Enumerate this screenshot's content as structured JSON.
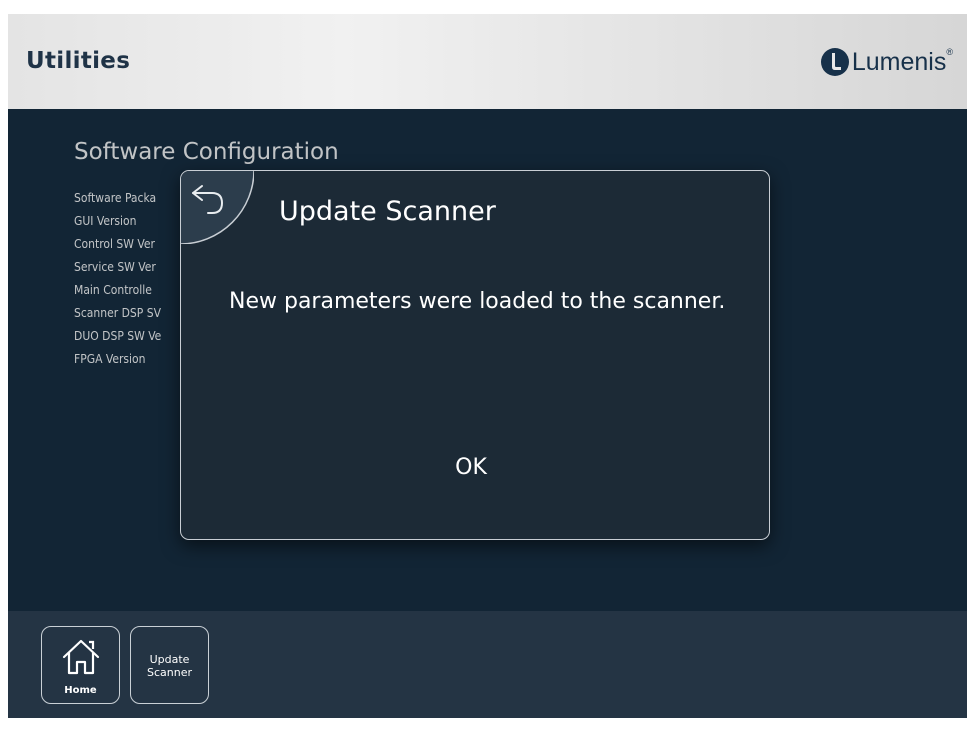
{
  "header": {
    "title": "Utilities",
    "logo_text": "Lumenis",
    "logo_reg": "®",
    "brand_color": "#17314a"
  },
  "main": {
    "section_title": "Software Configuration",
    "info_rows": [
      "Software Packa",
      "GUI Version",
      "Control SW Ver",
      "Service SW Ver",
      "Main Controlle",
      "Scanner DSP SV",
      "DUO DSP SW Ve",
      "FPGA Version"
    ]
  },
  "dialog": {
    "title": "Update Scanner",
    "message": "New parameters were loaded to the scanner.",
    "ok_label": "OK",
    "back_icon": "undo-arrow-icon"
  },
  "toolbar": {
    "home_label": "Home",
    "home_icon": "home-icon",
    "update_label": "Update\nScanner"
  },
  "colors": {
    "content_bg": "#162b3e",
    "toolbar_bg": "#243444",
    "dialog_bg": "#1c2a36"
  }
}
